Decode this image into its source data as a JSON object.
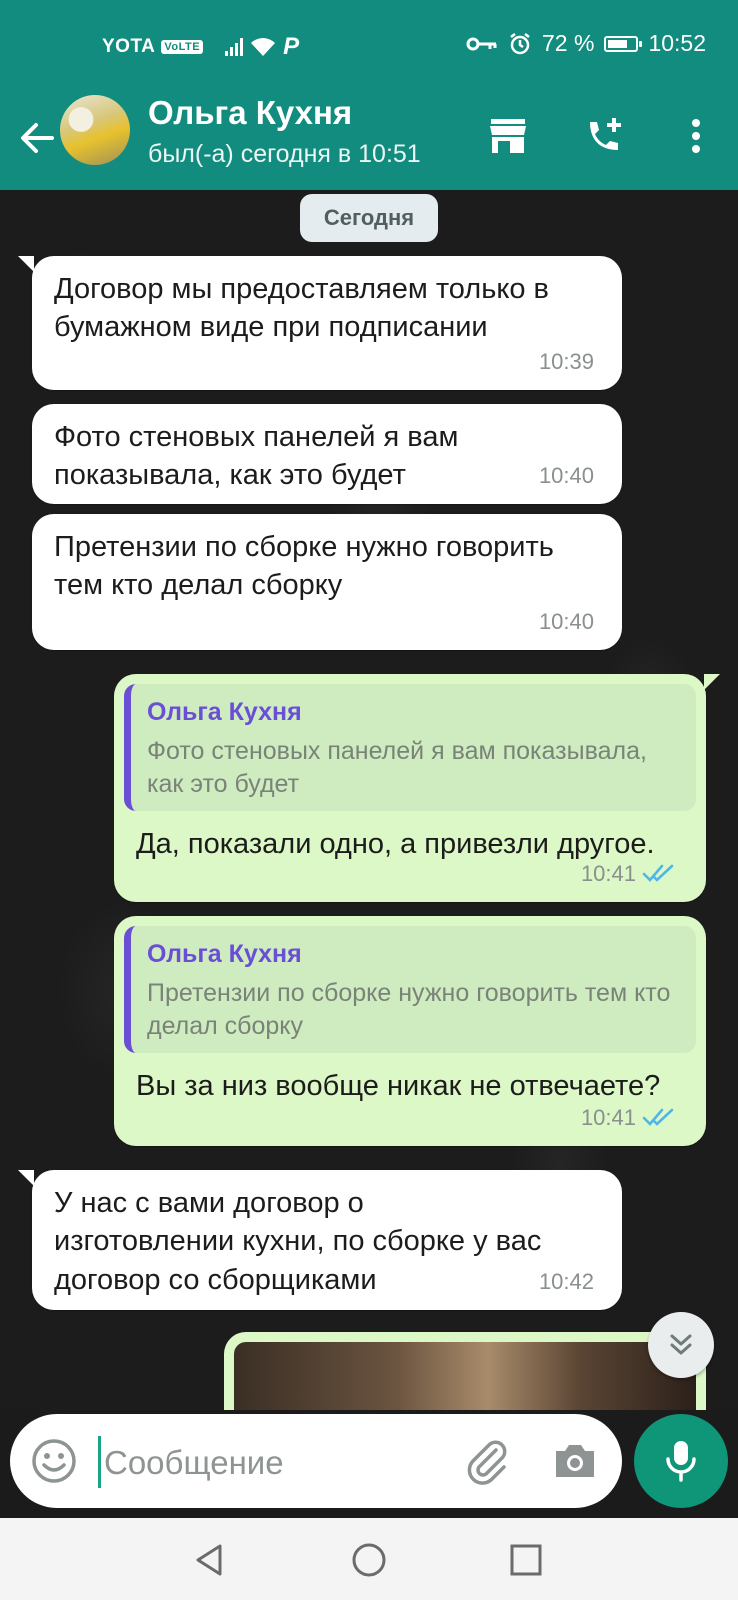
{
  "status_bar": {
    "carrier": "YOTA",
    "volte": "VoLTE",
    "battery": "72 %",
    "battery_level": 0.72,
    "time": "10:52"
  },
  "header": {
    "contact_name": "Ольга Кухня",
    "last_seen": "был(-а) сегодня в 10:51",
    "icons": [
      "back-arrow-icon",
      "store-icon",
      "add-call-icon",
      "more-vert-icon"
    ]
  },
  "date_separator": "Сегодня",
  "messages": [
    {
      "direction": "in",
      "text": "Договор мы предоставляем только в бумажном виде при подписании",
      "time": "10:39"
    },
    {
      "direction": "in",
      "text": "Фото стеновых панелей я вам показывала, как это будет",
      "time": "10:40"
    },
    {
      "direction": "in",
      "text": "Претензии по сборке нужно говорить тем кто делал сборку",
      "time": "10:40"
    },
    {
      "direction": "out",
      "quote_author": "Ольга Кухня",
      "quote_text": "Фото стеновых панелей я вам показывала, как это будет",
      "text": "Да, показали одно, а привезли другое.",
      "time": "10:41",
      "status": "read"
    },
    {
      "direction": "out",
      "quote_author": "Ольга Кухня",
      "quote_text": "Претензии по сборке нужно говорить тем кто делал сборку",
      "text": "Вы за низ вообще никак не отвечаете?",
      "time": "10:41",
      "status": "read"
    },
    {
      "direction": "in",
      "text": "У нас с вами договор о изготовлении кухни, по сборке у вас договор со сборщиками",
      "time": "10:42"
    }
  ],
  "composer": {
    "placeholder": "Сообщение",
    "icons": [
      "emoji-icon",
      "attach-icon",
      "camera-icon",
      "mic-icon"
    ]
  },
  "colors": {
    "header": "#128c7e",
    "incoming_bubble": "#ffffff",
    "outgoing_bubble": "#dcf8c6",
    "quote_accent": "#6a4fd6",
    "read_ticks": "#4fb6ec",
    "mic_button": "#0f9577"
  }
}
